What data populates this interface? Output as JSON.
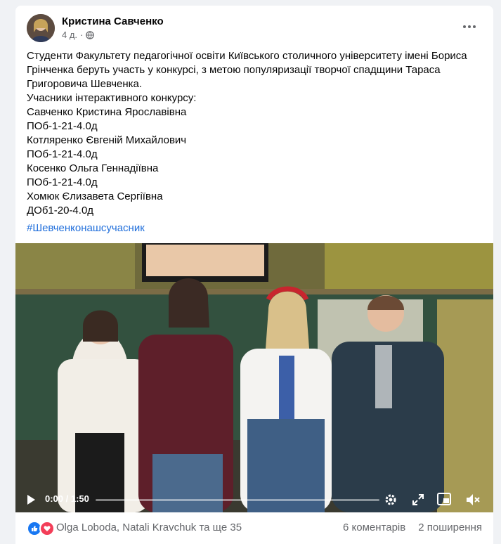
{
  "post": {
    "author": "Кристина Савченко",
    "time": "4 д.",
    "privacy_icon": "globe-icon",
    "lines": [
      "Студенти Факультету педагогічної освіти Київського столичного університету імені Бориса",
      "Грінченка беруть участь у конкурсі, з метою популяризації творчої спадщини Тараса",
      "Григоровича Шевченка.",
      "Учасники інтерактивного конкурсу:",
      "Савченко Кристина Ярославівна",
      "ПОб-1-21-4.0д",
      "Котляренко Євгеній Михайлович",
      "ПОб-1-21-4.0д",
      "Косенко Ольга Геннадіївна",
      "ПОб-1-21-4.0д",
      "Хомюк Єлизавета Сергіївна",
      "ДОб1-20-4.0д"
    ],
    "hashtag": "#Шевченконашсучасник"
  },
  "video": {
    "time": "0:00 / 1:50",
    "progress_fraction": 0.0
  },
  "footer": {
    "reactions_label": "Olga Loboda, Natali Kravchuk та ще 35",
    "comments": "6 коментарів",
    "shares": "2 поширення"
  },
  "colors": {
    "link": "#216fdb",
    "like": "#1877f2",
    "love": "#f33e58"
  }
}
